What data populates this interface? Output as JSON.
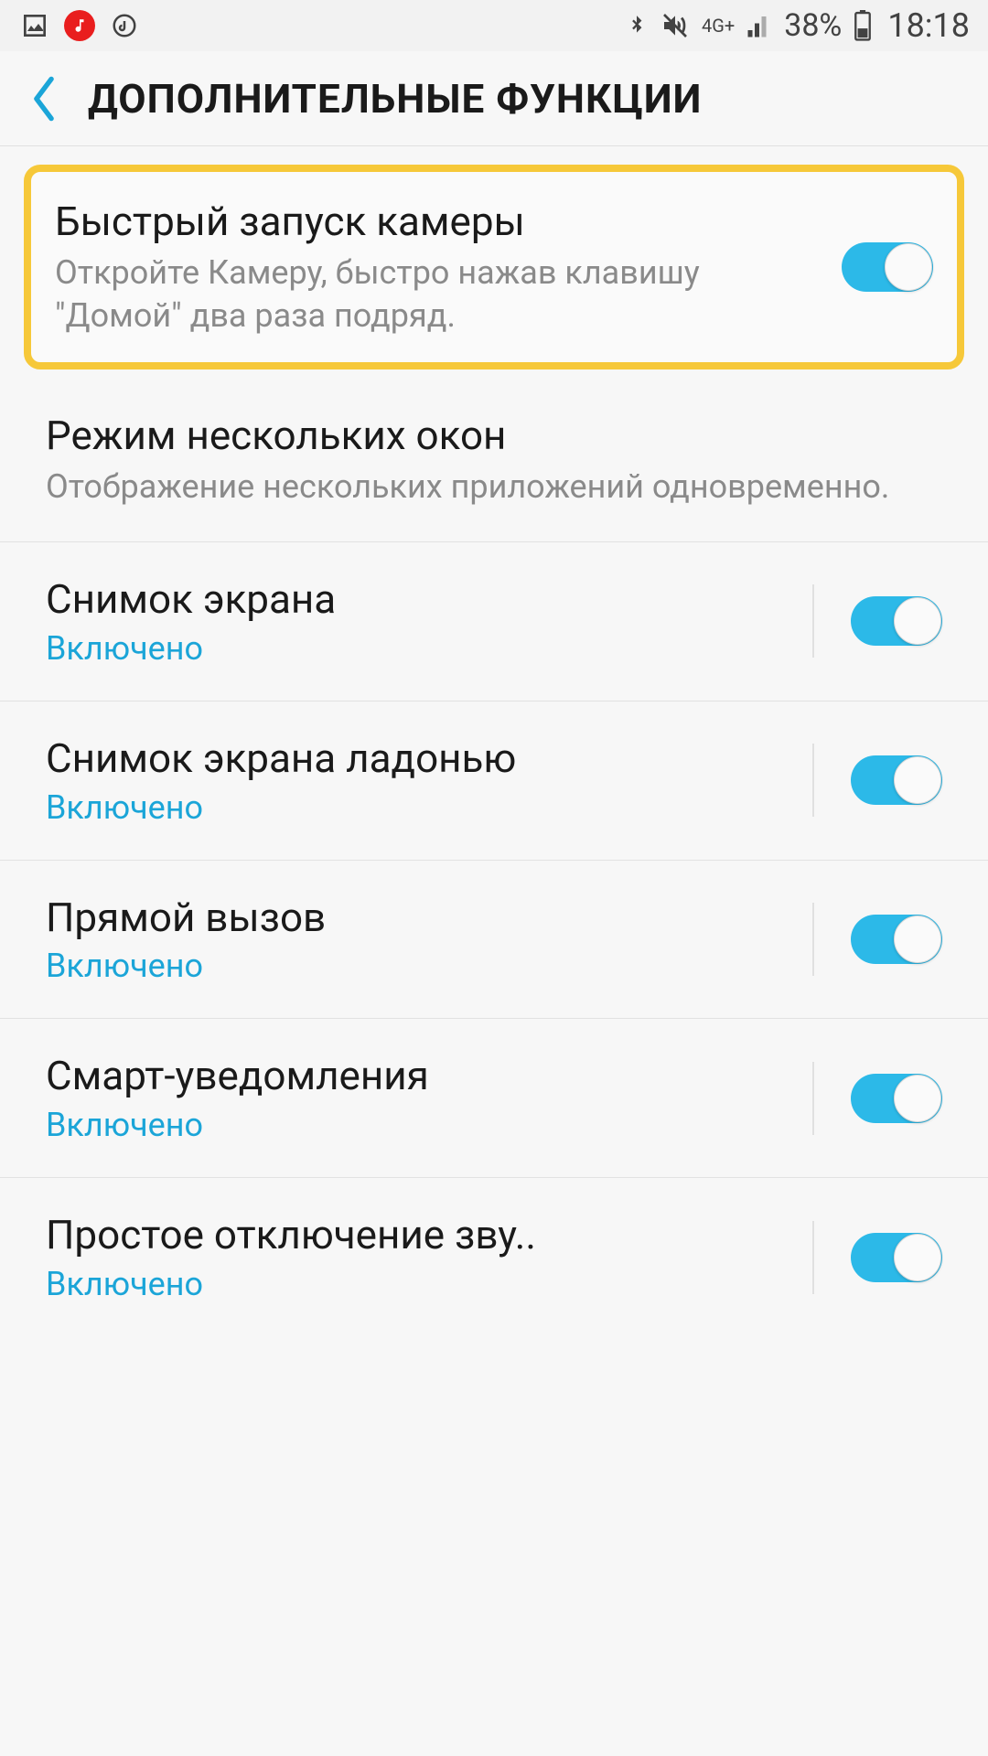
{
  "status": {
    "signal_text": "4G+",
    "battery_percent": "38%",
    "time": "18:18"
  },
  "header": {
    "title": "ДОПОЛНИТЕЛЬНЫЕ ФУНКЦИИ"
  },
  "items": [
    {
      "title": "Быстрый запуск камеры",
      "subtitle": "Откройте Камеру, быстро нажав клавишу \"Домой\" два раза подряд.",
      "toggle": true,
      "highlighted": true
    },
    {
      "title": "Режим нескольких окон",
      "subtitle": "Отображение нескольких приложений одновременно."
    },
    {
      "title": "Снимок экрана",
      "status": "Включено",
      "toggle": true
    },
    {
      "title": "Снимок экрана ладонью",
      "status": "Включено",
      "toggle": true
    },
    {
      "title": "Прямой вызов",
      "status": "Включено",
      "toggle": true
    },
    {
      "title": "Смарт-уведомления",
      "status": "Включено",
      "toggle": true
    },
    {
      "title": "Простое отключение зву..",
      "status": "Включено",
      "toggle": true
    }
  ]
}
